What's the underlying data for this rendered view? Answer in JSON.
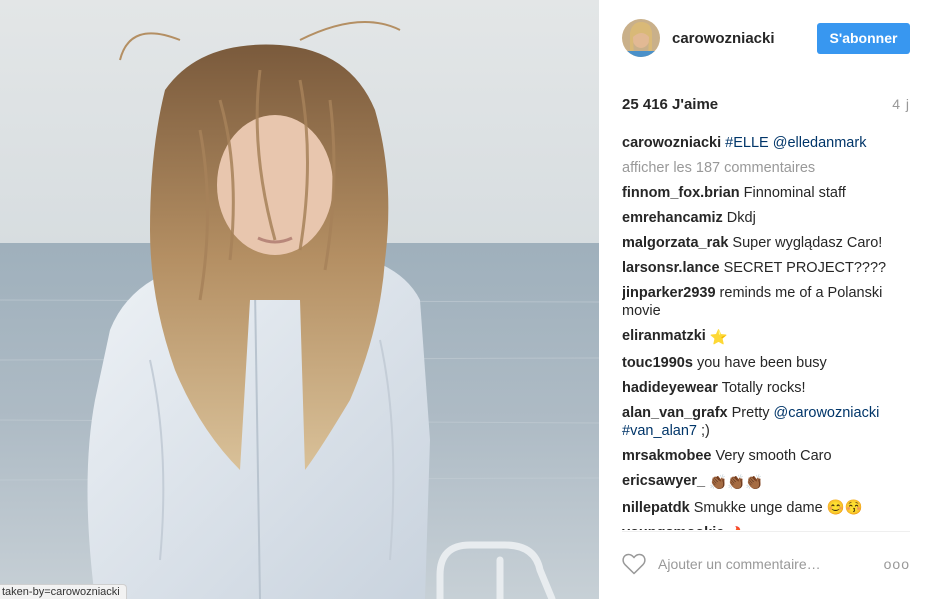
{
  "status_bar": {
    "url": "taken-by=carowozniacki"
  },
  "header": {
    "username": "carowozniacki",
    "follow_label": "S'abonner"
  },
  "stats": {
    "likes": "25 416 J'aime",
    "time_ago": "4 j"
  },
  "caption": {
    "author": "carowozniacki",
    "tags": [
      "#ELLE",
      "@elledanmark"
    ]
  },
  "view_all_comments": "afficher les 187 commentaires",
  "comments": [
    {
      "author": "finnom_fox.brian",
      "text": "Finnominal staff"
    },
    {
      "author": "emrehancamiz",
      "text": "Dkdj"
    },
    {
      "author": "malgorzata_rak",
      "text": "Super wyglądasz Caro!"
    },
    {
      "author": "larsonsr.lance",
      "text": "SECRET PROJECT????"
    },
    {
      "author": "jinparker2939",
      "text": "reminds me of a Polanski movie"
    },
    {
      "author": "eliranmatzki",
      "text": "⭐"
    },
    {
      "author": "touc1990s",
      "text": "you have been busy"
    },
    {
      "author": "hadideyewear",
      "text": "Totally rocks!"
    },
    {
      "author": "alan_van_grafx",
      "text": "Pretty",
      "mention": "@carowozniacki",
      "hashtag": "#van_alan7",
      "suffix": ";)"
    },
    {
      "author": "mrsakmobee",
      "text": "Very smooth Caro"
    },
    {
      "author": "ericsawyer_",
      "text": "👏🏾👏🏾👏🏾"
    },
    {
      "author": "nillepatdk",
      "text": "Smukke unge dame 😊😚"
    },
    {
      "author": "youngsmookie",
      "text": "🔥"
    }
  ],
  "add_comment": {
    "placeholder": "Ajouter un commentaire…"
  },
  "more_options": "ooo",
  "icons": {
    "like": "heart-outline-icon",
    "more": "more-options-icon"
  },
  "colors": {
    "accent": "#3897f0",
    "link": "#003569",
    "muted": "#999999"
  }
}
